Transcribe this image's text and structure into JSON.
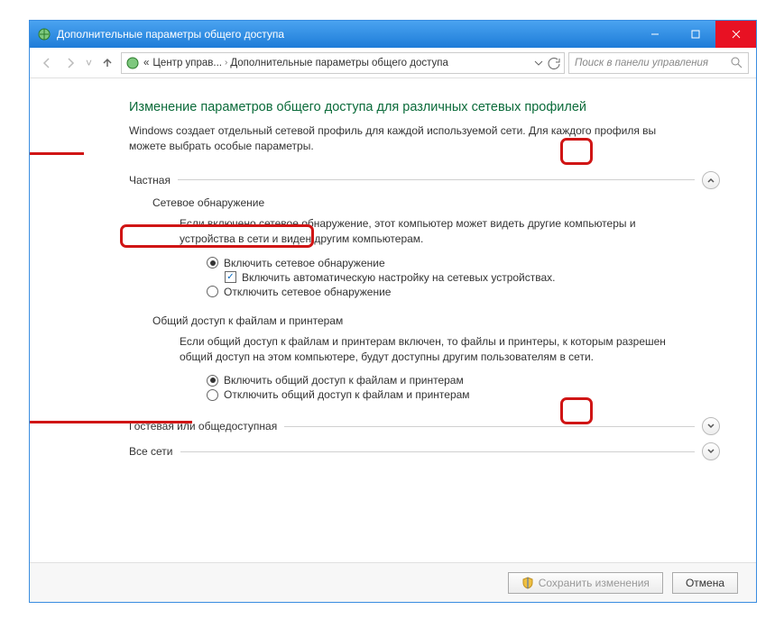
{
  "window": {
    "title": "Дополнительные параметры общего доступа"
  },
  "breadcrumb": {
    "prefix": "«",
    "part1": "Центр управ...",
    "part2": "Дополнительные параметры общего доступа"
  },
  "search": {
    "placeholder": "Поиск в панели управления"
  },
  "page": {
    "heading": "Изменение параметров общего доступа для различных сетевых профилей",
    "description": "Windows создает отдельный сетевой профиль для каждой используемой сети. Для каждого профиля вы можете выбрать особые параметры."
  },
  "profiles": {
    "private": {
      "label": "Частная",
      "network_discovery": {
        "title": "Сетевое обнаружение",
        "desc": "Если включено сетевое обнаружение, этот компьютер может видеть другие компьютеры и устройства в сети и виден другим компьютерам.",
        "opt_on": "Включить сетевое обнаружение",
        "opt_auto": "Включить автоматическую настройку на сетевых устройствах.",
        "opt_off": "Отключить сетевое обнаружение"
      },
      "file_sharing": {
        "title": "Общий доступ к файлам и принтерам",
        "desc": "Если общий доступ к файлам и принтерам включен, то файлы и принтеры, к которым разрешен общий доступ на этом компьютере, будут доступны другим пользователям в сети.",
        "opt_on": "Включить общий доступ к файлам и принтерам",
        "opt_off": "Отключить общий доступ к файлам и принтерам"
      }
    },
    "guest": {
      "label": "Гостевая или общедоступная"
    },
    "all": {
      "label": "Все сети"
    }
  },
  "footer": {
    "save": "Сохранить изменения",
    "cancel": "Отмена"
  }
}
